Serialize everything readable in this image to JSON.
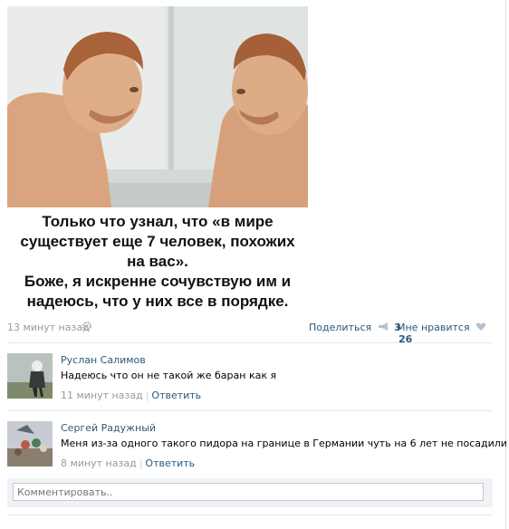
{
  "post": {
    "image_icon": "mirror-photo",
    "caption_lines": [
      "Только что узнал, что «в мире",
      "существует еще 7 человек, похожих",
      "на вас».",
      "Боже, я искренне сочувствую им и",
      "надеюсь, что у них все в порядке."
    ],
    "timestamp": "13 минут назад",
    "share_label": "Поделиться",
    "share_count": "3",
    "like_label": "Мне нравится",
    "like_count": "26"
  },
  "comments": [
    {
      "author": "Руслан Салимов",
      "text": "Надеюсь что он не такой же баран как я",
      "time": "11 минут назад",
      "reply_label": "Ответить"
    },
    {
      "author": "Сергей Радужный",
      "text": "Меня из-за одного такого пидора на границе в Германии чуть на 6 лет не посадили",
      "time": "8 минут назад",
      "reply_label": "Ответить"
    }
  ],
  "comment_box": {
    "placeholder": "Комментировать.."
  },
  "colors": {
    "link": "#2b587a",
    "muted": "#999999"
  }
}
